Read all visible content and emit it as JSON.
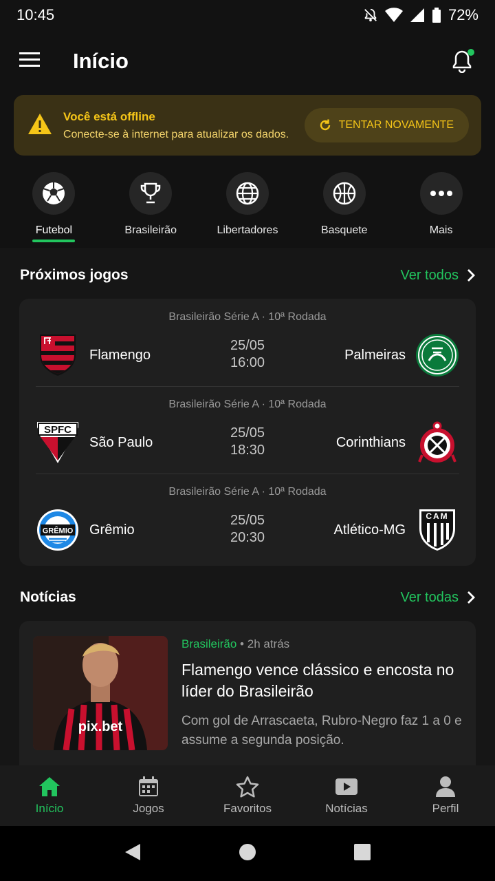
{
  "status": {
    "time": "10:45",
    "battery": "72%"
  },
  "header": {
    "title": "Início"
  },
  "offline_banner": {
    "title": "Você está offline",
    "message": "Conecte-se à internet para atualizar os dados.",
    "retry_label": "TENTAR NOVAMENTE"
  },
  "categories": [
    {
      "label": "Futebol",
      "icon": "soccer-ball-icon",
      "active": true
    },
    {
      "label": "Brasileirão",
      "icon": "trophy-icon"
    },
    {
      "label": "Libertadores",
      "icon": "globe-icon"
    },
    {
      "label": "Basquete",
      "icon": "basketball-icon"
    },
    {
      "label": "Mais",
      "icon": "more-icon"
    }
  ],
  "upcoming": {
    "title": "Próximos jogos",
    "see_all": "Ver todos",
    "games": [
      {
        "league": "Brasileirão Série A · 10ª Rodada",
        "home": "Flamengo",
        "away": "Palmeiras",
        "date": "25/05",
        "time": "16:00"
      },
      {
        "league": "Brasileirão Série A · 10ª Rodada",
        "home": "São Paulo",
        "away": "Corinthians",
        "date": "25/05",
        "time": "18:30"
      },
      {
        "league": "Brasileirão Série A · 10ª Rodada",
        "home": "Grêmio",
        "away": "Atlético-MG",
        "date": "25/05",
        "time": "20:30"
      }
    ]
  },
  "news": {
    "title": "Notícias",
    "see_all": "Ver todas",
    "items": [
      {
        "category": "Brasileirão",
        "age": "2h atrás",
        "headline": "Flamengo vence clássico e encosta no líder do Brasileirão",
        "summary": "Com gol de Arrascaeta, Rubro-Negro faz 1 a 0 e assume a segunda posição.",
        "shirt_text": "pix.bet"
      }
    ]
  },
  "crests": {
    "spfc": "SPFC",
    "gremio": "GRÊMIO",
    "cam": "CAM"
  },
  "bottom_nav": [
    {
      "label": "Início",
      "active": true
    },
    {
      "label": "Jogos"
    },
    {
      "label": "Favoritos"
    },
    {
      "label": "Notícias"
    },
    {
      "label": "Perfil"
    }
  ],
  "colors": {
    "accent": "#22c55e",
    "warning": "#f5c518",
    "background": "#121212"
  }
}
